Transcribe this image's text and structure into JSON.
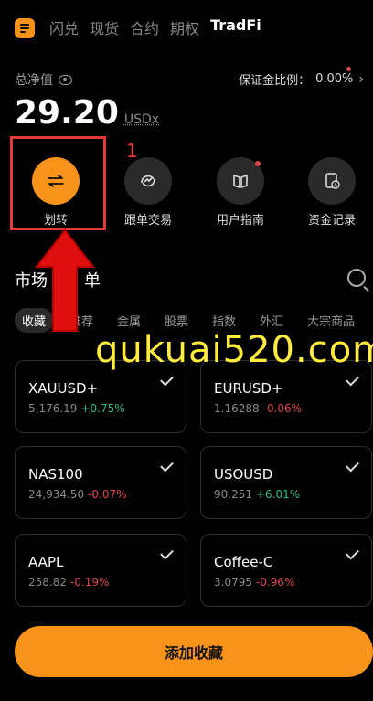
{
  "tabs": [
    "闪兑",
    "现货",
    "合约",
    "期权",
    "TradFi"
  ],
  "active_tab": "TradFi",
  "account": {
    "net_value_label": "总净值",
    "margin_ratio_label": "保证金比例：",
    "margin_ratio_value": "0.00%",
    "balance": "29.20",
    "balance_unit": "USDx"
  },
  "actions": [
    {
      "label": "划转",
      "icon": "transfer-icon"
    },
    {
      "label": "跟单交易",
      "icon": "copy-trade-icon"
    },
    {
      "label": "用户指南",
      "icon": "guide-book-icon"
    },
    {
      "label": "资金记录",
      "icon": "fund-record-icon"
    }
  ],
  "annotation": {
    "step_number": "1"
  },
  "market": {
    "title_visible_left": "市场",
    "title_visible_right": "单",
    "filters": [
      "收藏",
      "推荐",
      "金属",
      "股票",
      "指数",
      "外汇",
      "大宗商品"
    ],
    "active_filter": "收藏",
    "items": [
      {
        "symbol": "XAUUSD+",
        "price": "5,176.19",
        "change": "+0.75%",
        "direction": "up"
      },
      {
        "symbol": "EURUSD+",
        "price": "1.16288",
        "change": "-0.06%",
        "direction": "down"
      },
      {
        "symbol": "NAS100",
        "price": "24,934.50",
        "change": "-0.07%",
        "direction": "down"
      },
      {
        "symbol": "USOUSD",
        "price": "90.251",
        "change": "+6.01%",
        "direction": "up"
      },
      {
        "symbol": "AAPL",
        "price": "258.82",
        "change": "-0.19%",
        "direction": "down"
      },
      {
        "symbol": "Coffee-C",
        "price": "3.0795",
        "change": "-0.96%",
        "direction": "down"
      }
    ]
  },
  "add_favorite_button": "添加收藏",
  "watermark": "qukuai520.com",
  "colors": {
    "accent": "#f7931a",
    "up": "#2ebd85",
    "down": "#e0454a",
    "annotation": "#e53935"
  }
}
